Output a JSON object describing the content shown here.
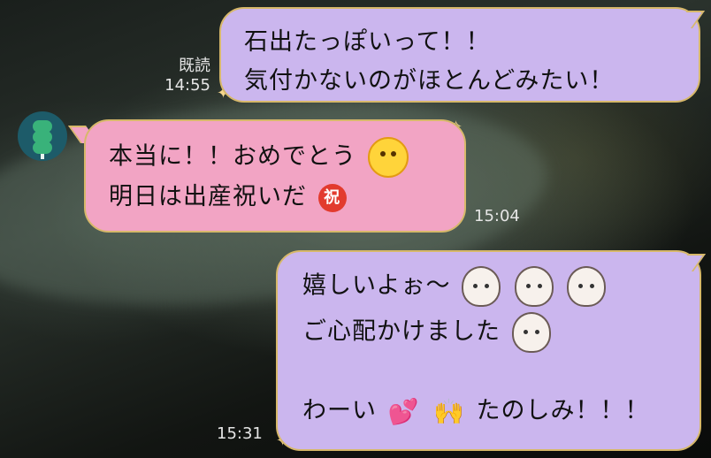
{
  "messages": [
    {
      "lines": [
        "石出たっぽいって！！",
        "気付かないのがほとんどみたい！"
      ],
      "read_label": "既読",
      "time": "14:55"
    },
    {
      "lines": [
        "本当に！！おめでとう",
        "明日は出産祝いだ"
      ],
      "badge": "祝",
      "time": "15:04"
    },
    {
      "lines": [
        "嬉しいよぉ〜",
        "ご心配かけました",
        "わーい",
        "たのしみ！！！"
      ],
      "time": "15:31",
      "heart_glyph": "💕",
      "hands_glyph": "🙌"
    }
  ],
  "colors": {
    "mine_bubble": "#cbb6ee",
    "their_bubble": "#f2a4c4",
    "avatar_bg": "#1d5b69"
  },
  "icons": [
    "dango-avatar-icon",
    "party-emoji-icon",
    "blob-sticker-icon",
    "heart-icon",
    "raised-hands-icon",
    "sparkle-icon"
  ]
}
